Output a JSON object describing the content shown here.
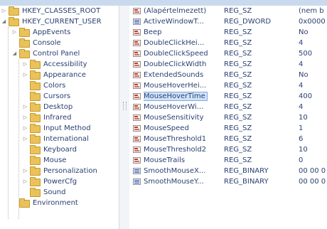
{
  "tree": [
    {
      "label": "HKEY_CLASSES_ROOT",
      "level": 0,
      "toggle": "▷"
    },
    {
      "label": "HKEY_CURRENT_USER",
      "level": 0,
      "toggle": "◢"
    },
    {
      "label": "AppEvents",
      "level": 1,
      "toggle": "▷"
    },
    {
      "label": "Console",
      "level": 1,
      "toggle": ""
    },
    {
      "label": "Control Panel",
      "level": 1,
      "toggle": "◢"
    },
    {
      "label": "Accessibility",
      "level": 2,
      "toggle": "▷"
    },
    {
      "label": "Appearance",
      "level": 2,
      "toggle": "▷"
    },
    {
      "label": "Colors",
      "level": 2,
      "toggle": ""
    },
    {
      "label": "Cursors",
      "level": 2,
      "toggle": ""
    },
    {
      "label": "Desktop",
      "level": 2,
      "toggle": "▷"
    },
    {
      "label": "Infrared",
      "level": 2,
      "toggle": "▷"
    },
    {
      "label": "Input Method",
      "level": 2,
      "toggle": "▷"
    },
    {
      "label": "International",
      "level": 2,
      "toggle": "▷"
    },
    {
      "label": "Keyboard",
      "level": 2,
      "toggle": ""
    },
    {
      "label": "Mouse",
      "level": 2,
      "toggle": ""
    },
    {
      "label": "Personalization",
      "level": 2,
      "toggle": "▷"
    },
    {
      "label": "PowerCfg",
      "level": 2,
      "toggle": "▷"
    },
    {
      "label": "Sound",
      "level": 2,
      "toggle": ""
    },
    {
      "label": "Environment",
      "level": 1,
      "toggle": ""
    }
  ],
  "values": [
    {
      "name": "(Alapértelmezett)",
      "type": "REG_SZ",
      "data": "(nem b",
      "icon": "string-value-icon",
      "kind": "sz"
    },
    {
      "name": "ActiveWindowT...",
      "type": "REG_DWORD",
      "data": "0x0000",
      "icon": "binary-value-icon",
      "kind": "bin"
    },
    {
      "name": "Beep",
      "type": "REG_SZ",
      "data": "No",
      "icon": "string-value-icon",
      "kind": "sz"
    },
    {
      "name": "DoubleClickHei...",
      "type": "REG_SZ",
      "data": "4",
      "icon": "string-value-icon",
      "kind": "sz"
    },
    {
      "name": "DoubleClickSpeed",
      "type": "REG_SZ",
      "data": "500",
      "icon": "string-value-icon",
      "kind": "sz"
    },
    {
      "name": "DoubleClickWidth",
      "type": "REG_SZ",
      "data": "4",
      "icon": "string-value-icon",
      "kind": "sz"
    },
    {
      "name": "ExtendedSounds",
      "type": "REG_SZ",
      "data": "No",
      "icon": "string-value-icon",
      "kind": "sz"
    },
    {
      "name": "MouseHoverHei...",
      "type": "REG_SZ",
      "data": "4",
      "icon": "string-value-icon",
      "kind": "sz"
    },
    {
      "name": "MouseHoverTime",
      "type": "REG_SZ",
      "data": "400",
      "icon": "string-value-icon",
      "kind": "sz",
      "selected": true
    },
    {
      "name": "MouseHoverWi...",
      "type": "REG_SZ",
      "data": "4",
      "icon": "string-value-icon",
      "kind": "sz"
    },
    {
      "name": "MouseSensitivity",
      "type": "REG_SZ",
      "data": "10",
      "icon": "string-value-icon",
      "kind": "sz"
    },
    {
      "name": "MouseSpeed",
      "type": "REG_SZ",
      "data": "1",
      "icon": "string-value-icon",
      "kind": "sz"
    },
    {
      "name": "MouseThreshold1",
      "type": "REG_SZ",
      "data": "6",
      "icon": "string-value-icon",
      "kind": "sz"
    },
    {
      "name": "MouseThreshold2",
      "type": "REG_SZ",
      "data": "10",
      "icon": "string-value-icon",
      "kind": "sz"
    },
    {
      "name": "MouseTrails",
      "type": "REG_SZ",
      "data": "0",
      "icon": "string-value-icon",
      "kind": "sz"
    },
    {
      "name": "SmoothMouseX...",
      "type": "REG_BINARY",
      "data": "00 00 0",
      "icon": "binary-value-icon",
      "kind": "bin"
    },
    {
      "name": "SmoothMouseY...",
      "type": "REG_BINARY",
      "data": "00 00 0",
      "icon": "binary-value-icon",
      "kind": "bin"
    }
  ]
}
